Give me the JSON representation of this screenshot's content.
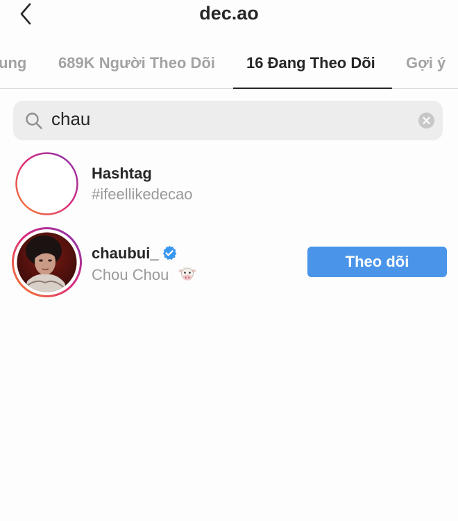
{
  "header": {
    "title": "dec.ao",
    "back_icon": "chevron-left-icon"
  },
  "tabs": [
    {
      "label": "ung",
      "active": false
    },
    {
      "label": "689K Người Theo Dõi",
      "active": false
    },
    {
      "label": "16 Đang Theo Dõi",
      "active": true
    },
    {
      "label": "Gợi ý",
      "active": false
    }
  ],
  "search": {
    "value": "chau",
    "search_icon": "search-icon",
    "clear_icon": "clear-icon"
  },
  "results": [
    {
      "type": "hashtag",
      "title": "Hashtag",
      "subtitle": "#ifeellikedecao",
      "icon": "hashtag-icon"
    },
    {
      "type": "user",
      "username": "chaubui_",
      "verified": true,
      "full_name": "Chou Chou",
      "emoji_icon": "cow-face-icon",
      "button_label": "Theo dõi"
    }
  ],
  "colors": {
    "accent": "#4a95ea",
    "verified": "#3897f0",
    "gradient_start": "#f58529",
    "gradient_end": "#8134af"
  }
}
